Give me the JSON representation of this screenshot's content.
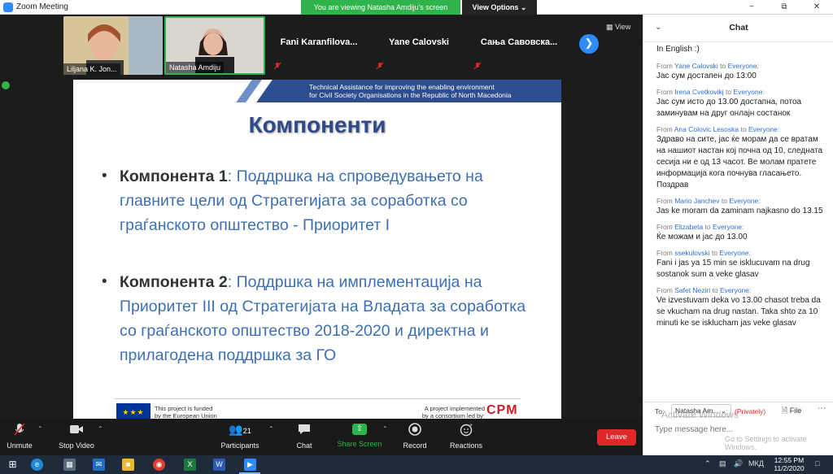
{
  "window": {
    "title": "Zoom Meeting",
    "banner": "You are viewing Natasha Amdiju's screen",
    "view_options": "View Options ⌄",
    "minimize": "−",
    "maximize": "⧉",
    "close": "✕"
  },
  "participants": [
    {
      "name": "Liljana K. Jon...",
      "video": true
    },
    {
      "name": "Natasha Amdiju",
      "video": true
    },
    {
      "name": "Fani  Karanfilova...",
      "video": false
    },
    {
      "name": "Yane Calovski",
      "video": false
    },
    {
      "name": "Сања  Савовска...",
      "video": false
    }
  ],
  "view_button": "View",
  "slide": {
    "header_line1": "Technical Assistance for improving the enabling environment",
    "header_line2": "for Civil Society Organisations in the Republic of North Macedonia",
    "title": "Компоненти",
    "bullets": [
      {
        "lead": "Компонента 1",
        "text": ": Поддршка на спроведувањето на главните цели од Стратегијата за соработка со граѓанското општество - Приоритет I"
      },
      {
        "lead": "Компонента 2",
        "text": ": Поддршка на имплементација на Приоритет III од Стратегијата на Владата за соработка со граѓанското општество 2018-2020 и директна и прилагодена поддршка за ГО"
      }
    ],
    "eu_line1": "This project is funded",
    "eu_line2": "by the European Union",
    "impl_line1": "A project implemented",
    "impl_line2": "by a consortium led by:",
    "cpm": "CPM"
  },
  "toolbar": {
    "unmute": "Unmute",
    "stop_video": "Stop Video",
    "participants": "Participants",
    "participants_count": "21",
    "chat": "Chat",
    "share_screen": "Share Screen",
    "record": "Record",
    "reactions": "Reactions",
    "leave": "Leave"
  },
  "chat": {
    "title": "Chat",
    "first_line": "In English :)",
    "to_word": "to",
    "messages": [
      {
        "from": "Yane Calovski",
        "to": "Everyone",
        "text": "Јас сум достапен до 13:00"
      },
      {
        "from": "Irena Cvetkovikj",
        "to": "Everyone",
        "text": "Јас сум исто до 13.00 достапна, потоа заминувам на друг онлајн состанок"
      },
      {
        "from": "Ana Colovic Lesoska",
        "to": "Everyone",
        "text": "Здраво на сите, јас ќе морам да се вратам на нашиот настан кој почна од 10, следната сесија ни е од 13 часот. Ве молам пратете информација кога почнува гласањето. Поздрав"
      },
      {
        "from": "Mario Janchev",
        "to": "Everyone",
        "text": "Jas ke moram da zaminam najkasno do 13.15"
      },
      {
        "from": "Elizabeta",
        "to": "Everyone",
        "text": "Ќе можам и јас до 13.00"
      },
      {
        "from": "ssekulovski",
        "to": "Everyone",
        "text": "Fani i jas ya 15 min se isklucuvam na drug sostanok sum a veke glasav"
      },
      {
        "from": "Safet Neziri",
        "to": "Everyone",
        "text": "Ve izvestuvam deka vo 13.00 chasot treba da se vkucham na drug nastan. Taka shto za 10 minuti ke se isklucham jas veke glasav"
      }
    ],
    "to_label": "To:",
    "recipient": "Natasha Am...",
    "privately": "(Privately)",
    "file": "File",
    "input_placeholder": "Type message here...",
    "watermark_line1": "Activate Windows",
    "watermark_line2": "Go to Settings to activate Windows."
  },
  "taskbar": {
    "language": "МКД",
    "time": "12:55 PM",
    "date": "11/2/2020"
  },
  "colors": {
    "zoom_blue": "#2d8cff",
    "banner_green": "#2fb34a",
    "leave_red": "#e02828",
    "slide_blue": "#2d4e8e"
  }
}
